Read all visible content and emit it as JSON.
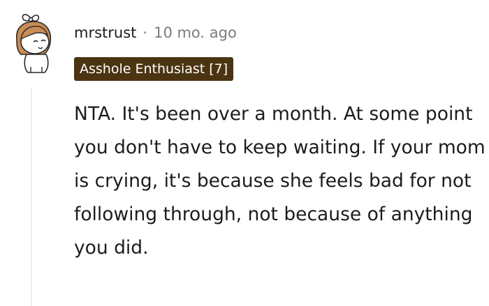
{
  "comment": {
    "username": "mrstrust",
    "separator": "·",
    "timestamp": "10 mo. ago",
    "flair": "Asshole Enthusiast [7]",
    "body": "NTA. It's been over a month. At some point you don't have to keep waiting. If your mom is crying, it's because she feels bad for not following through, not because of anything you did.",
    "avatar_icon": "snoo-avatar-icon",
    "colors": {
      "flair_bg": "#4b3411",
      "flair_text": "#ffffff",
      "meta_text": "#7c7c7c",
      "body_text": "#1c1c1c",
      "hair": "#c98c55",
      "thread_line": "#edeff1"
    }
  }
}
